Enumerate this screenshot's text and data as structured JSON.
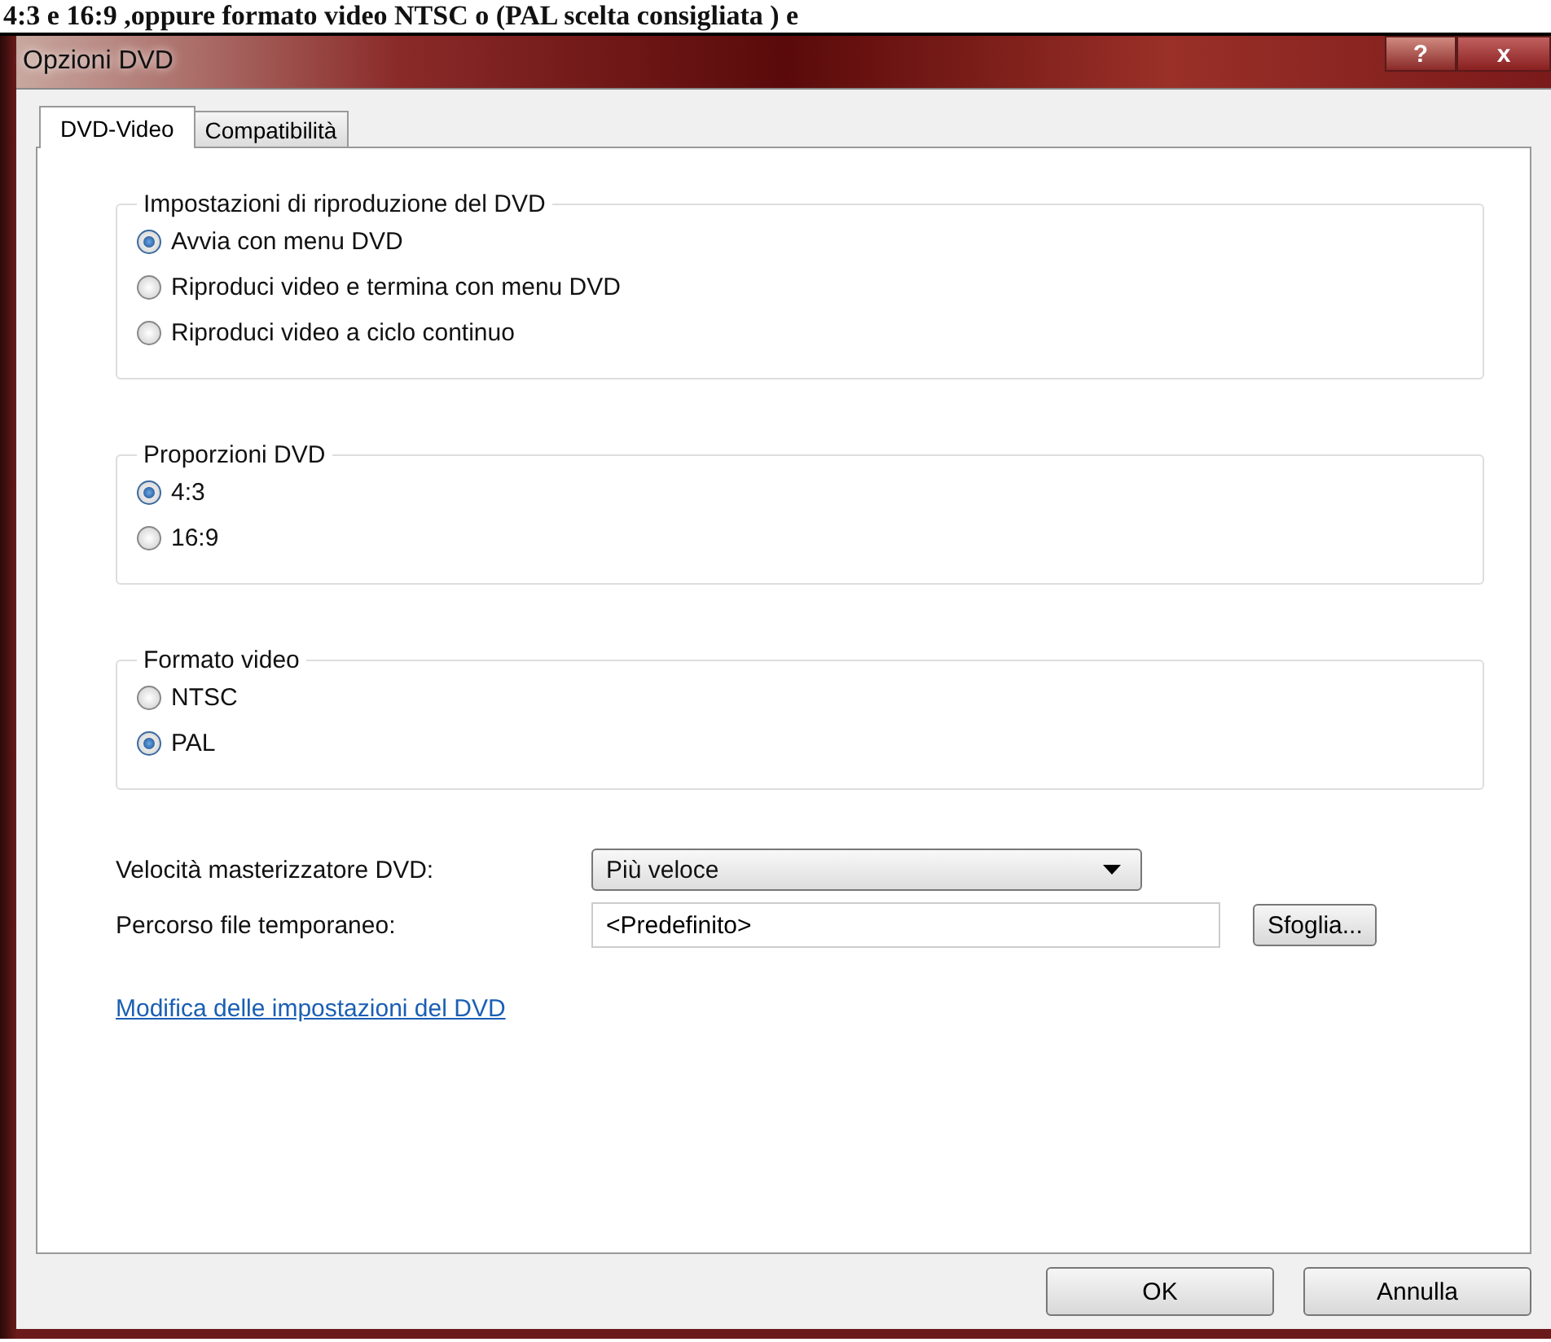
{
  "caption": "4:3 e 16:9 ,oppure formato video NTSC o (PAL  scelta consigliata ) e",
  "window": {
    "title": "Opzioni DVD",
    "help": "?",
    "close": "x"
  },
  "tabs": [
    {
      "label": "DVD-Video",
      "selected": true
    },
    {
      "label": "Compatibilità",
      "selected": false
    }
  ],
  "groups": [
    {
      "title": "Impostazioni di riproduzione del DVD",
      "options": [
        {
          "label": "Avvia con menu DVD",
          "selected": true
        },
        {
          "label": "Riproduci video e termina con menu DVD",
          "selected": false
        },
        {
          "label": "Riproduci video a ciclo continuo",
          "selected": false
        }
      ]
    },
    {
      "title": "Proporzioni DVD",
      "options": [
        {
          "label": "4:3",
          "selected": true
        },
        {
          "label": "16:9",
          "selected": false
        }
      ]
    },
    {
      "title": "Formato video",
      "options": [
        {
          "label": "NTSC",
          "selected": false
        },
        {
          "label": "PAL",
          "selected": true
        }
      ]
    }
  ],
  "burn_speed": {
    "label": "Velocità masterizzatore DVD:",
    "value": "Più veloce"
  },
  "temp_path": {
    "label": "Percorso file temporaneo:",
    "value": "<Predefinito>",
    "button": "Sfoglia..."
  },
  "link": "Modifica delle impostazioni del DVD",
  "buttons": [
    "OK",
    "Annulla"
  ]
}
